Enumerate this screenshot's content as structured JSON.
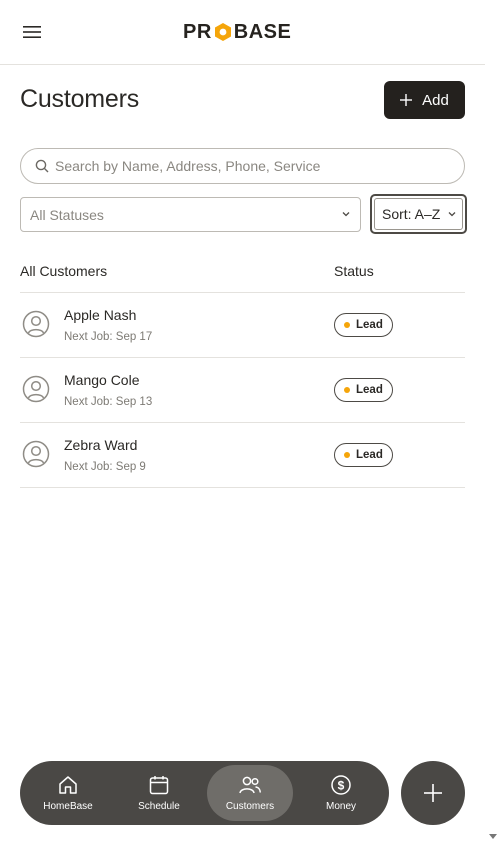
{
  "header": {
    "logo_text_left": "PR",
    "logo_text_right": "BASE",
    "logo_full": "PROBASE"
  },
  "page": {
    "title": "Customers",
    "add_label": "Add"
  },
  "search": {
    "placeholder": "Search by Name, Address, Phone, Service"
  },
  "filters": {
    "status_selected": "All Statuses",
    "sort_selected": "Sort: A–Z"
  },
  "list": {
    "col_customers": "All Customers",
    "col_status": "Status",
    "rows": [
      {
        "name": "Apple Nash",
        "next_job": "Next Job: Sep 17",
        "status": "Lead"
      },
      {
        "name": "Mango Cole",
        "next_job": "Next Job: Sep 13",
        "status": "Lead"
      },
      {
        "name": "Zebra Ward",
        "next_job": "Next Job: Sep 9",
        "status": "Lead"
      }
    ]
  },
  "bottom_nav": {
    "items": [
      {
        "label": "HomeBase",
        "icon": "home-icon"
      },
      {
        "label": "Schedule",
        "icon": "calendar-icon"
      },
      {
        "label": "Customers",
        "icon": "users-icon",
        "active": true
      },
      {
        "label": "Money",
        "icon": "dollar-circle-icon"
      }
    ]
  },
  "colors": {
    "brand_dark": "#24211e",
    "lead_dot": "#f5a50a",
    "nav_bg": "#4a4845",
    "logo_accent": "#f5a50a"
  }
}
